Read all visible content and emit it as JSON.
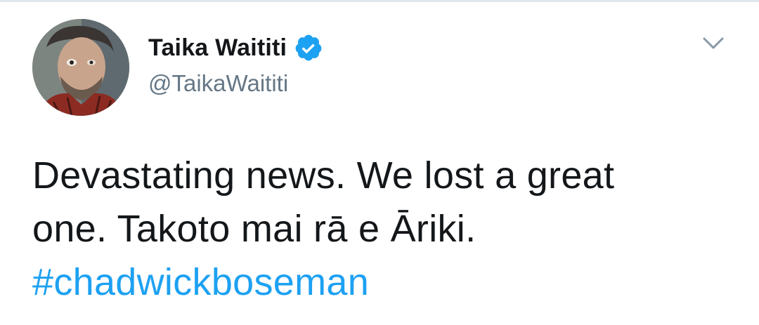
{
  "user": {
    "display_name": "Taika Waititi",
    "handle": "@TaikaWaititi",
    "verified": true,
    "avatar_icon": "profile-photo"
  },
  "tweet": {
    "line1": "Devastating news. We lost a great",
    "line2": "one. Takoto mai rā e Āriki.",
    "hashtag": "#chadwickboseman"
  },
  "icons": {
    "verified": "verified-badge-icon",
    "more": "chevron-down-icon"
  },
  "colors": {
    "text": "#14171a",
    "secondary": "#657786",
    "accent": "#1da1f2"
  }
}
